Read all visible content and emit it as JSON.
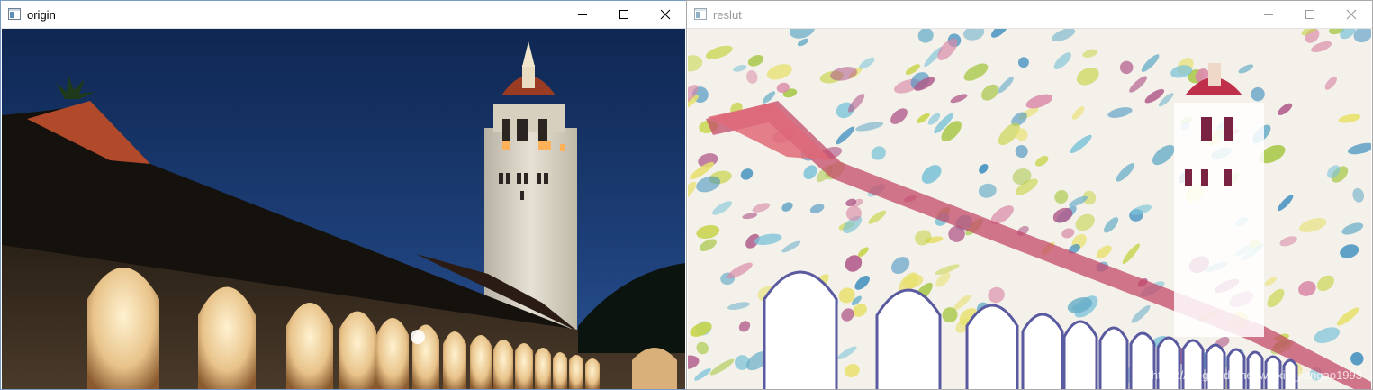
{
  "windows": [
    {
      "title": "origin"
    },
    {
      "title": "reslut"
    }
  ],
  "watermark": "https://blog.csdn.net/weixin_jiangao1993"
}
